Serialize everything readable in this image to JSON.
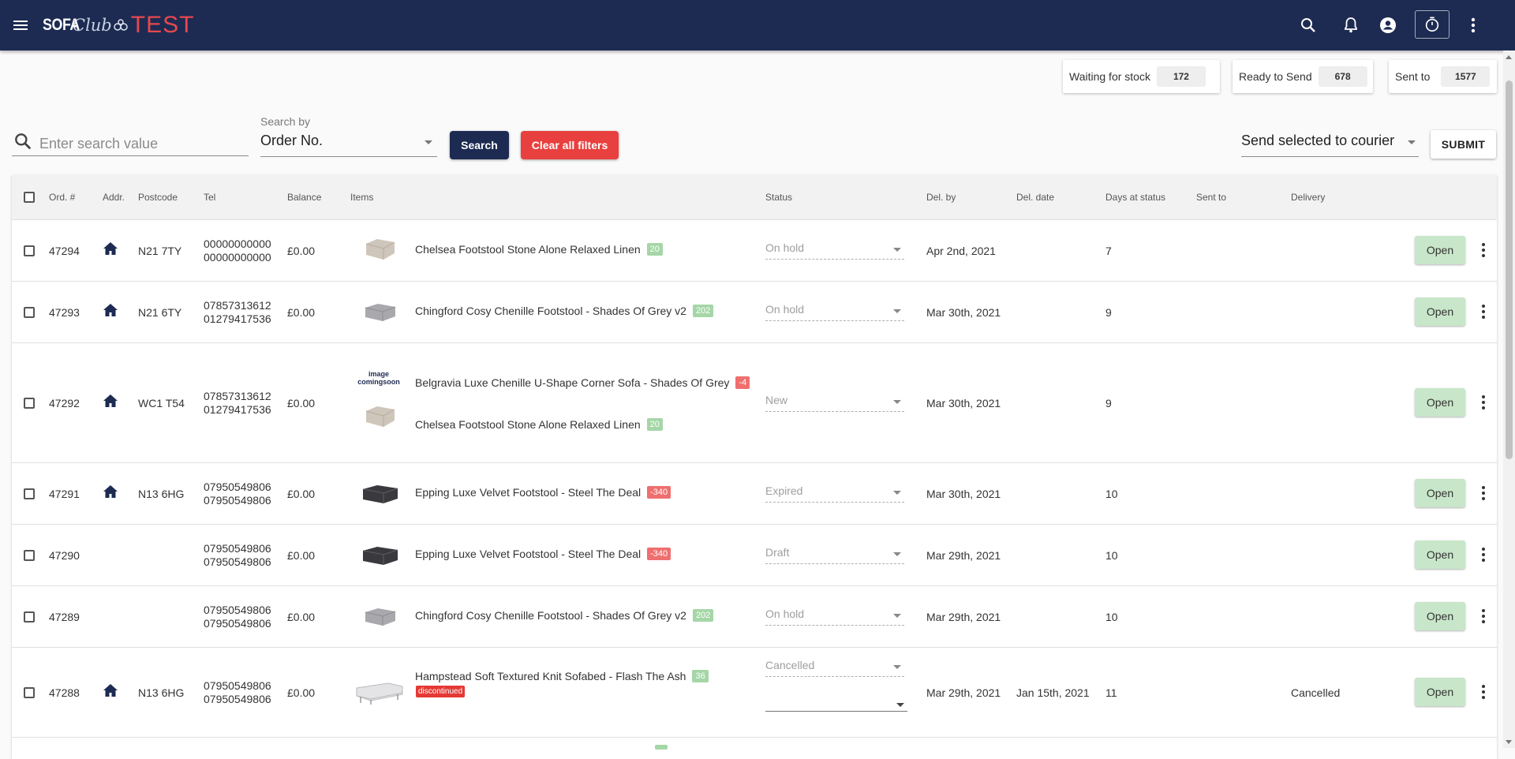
{
  "app": {
    "logo": {
      "part1": "SOFA",
      "part2": "Club",
      "part3": "TEST"
    },
    "colors": {
      "header": "#1d2b52",
      "danger": "#e8403e",
      "open": "#c8e6c9",
      "qty_ok": "#a5d6a7",
      "qty_neg": "#ef6f6f"
    }
  },
  "header_icons": [
    "menu-icon",
    "search-icon",
    "bell-icon",
    "account-icon",
    "timer-icon",
    "more-vert-icon"
  ],
  "counters": [
    {
      "label": "Waiting for stock",
      "value": "172"
    },
    {
      "label": "Ready to Send",
      "value": "678"
    },
    {
      "label": "Sent to",
      "value": "1577"
    }
  ],
  "search": {
    "placeholder": "Enter search value",
    "value": "",
    "search_by_label": "Search by",
    "search_by_value": "Order No.",
    "search_button": "Search",
    "clear_button": "Clear all filters",
    "courier_action": "Send selected to courier",
    "submit_button": "SUBMIT"
  },
  "table": {
    "columns": [
      "Ord. #",
      "Addr.",
      "Postcode",
      "Tel",
      "Balance",
      "Items",
      "Status",
      "Del. by",
      "Del. date",
      "Days at status",
      "Sent to",
      "Delivery"
    ],
    "open_label": "Open",
    "image_placeholder": "image comingsoon",
    "discontinued_label": "discontinued",
    "rows": [
      {
        "order": "47294",
        "has_address": true,
        "postcode": "N21 7TY",
        "tel1": "00000000000",
        "tel2": "00000000000",
        "balance": "£0.00",
        "items": [
          {
            "name": "Chelsea Footstool Stone Alone Relaxed Linen",
            "qty": "20",
            "qty_type": "green",
            "thumb": "footstool-beige"
          }
        ],
        "status": "On hold",
        "del_by": "Apr 2nd, 2021",
        "del_date": "",
        "days": "7",
        "sent_to": "",
        "delivery": ""
      },
      {
        "order": "47293",
        "has_address": true,
        "postcode": "N21 6TY",
        "tel1": "07857313612",
        "tel2": "01279417536",
        "balance": "£0.00",
        "items": [
          {
            "name": "Chingford Cosy Chenille Footstool - Shades Of Grey v2",
            "qty": "202",
            "qty_type": "green",
            "thumb": "footstool-grey"
          }
        ],
        "status": "On hold",
        "del_by": "Mar 30th, 2021",
        "del_date": "",
        "days": "9",
        "sent_to": "",
        "delivery": ""
      },
      {
        "order": "47292",
        "has_address": true,
        "postcode": "WC1 T54",
        "tel1": "07857313612",
        "tel2": "01279417536",
        "balance": "£0.00",
        "items": [
          {
            "name": "Belgravia Luxe Chenille U-Shape Corner Sofa - Shades Of Grey",
            "qty": "-4",
            "qty_type": "red",
            "thumb": "image-coming-soon"
          },
          {
            "name": "Chelsea Footstool Stone Alone Relaxed Linen",
            "qty": "20",
            "qty_type": "green",
            "thumb": "footstool-beige"
          }
        ],
        "status": "New",
        "del_by": "Mar 30th, 2021",
        "del_date": "",
        "days": "9",
        "sent_to": "",
        "delivery": ""
      },
      {
        "order": "47291",
        "has_address": true,
        "postcode": "N13 6HG",
        "tel1": "07950549806",
        "tel2": "07950549806",
        "balance": "£0.00",
        "items": [
          {
            "name": "Epping Luxe Velvet Footstool - Steel The Deal",
            "qty": "-340",
            "qty_type": "red",
            "thumb": "footstool-dark"
          }
        ],
        "status": "Expired",
        "del_by": "Mar 30th, 2021",
        "del_date": "",
        "days": "10",
        "sent_to": "",
        "delivery": ""
      },
      {
        "order": "47290",
        "has_address": false,
        "postcode": "",
        "tel1": "07950549806",
        "tel2": "07950549806",
        "balance": "£0.00",
        "items": [
          {
            "name": "Epping Luxe Velvet Footstool - Steel The Deal",
            "qty": "-340",
            "qty_type": "red",
            "thumb": "footstool-dark"
          }
        ],
        "status": "Draft",
        "del_by": "Mar 29th, 2021",
        "del_date": "",
        "days": "10",
        "sent_to": "",
        "delivery": ""
      },
      {
        "order": "47289",
        "has_address": false,
        "postcode": "",
        "tel1": "07950549806",
        "tel2": "07950549806",
        "balance": "£0.00",
        "items": [
          {
            "name": "Chingford Cosy Chenille Footstool - Shades Of Grey v2",
            "qty": "202",
            "qty_type": "green",
            "thumb": "footstool-grey"
          }
        ],
        "status": "On hold",
        "del_by": "Mar 29th, 2021",
        "del_date": "",
        "days": "10",
        "sent_to": "",
        "delivery": ""
      },
      {
        "order": "47288",
        "has_address": true,
        "postcode": "N13 6HG",
        "tel1": "07950549806",
        "tel2": "07950549806",
        "balance": "£0.00",
        "items": [
          {
            "name": "Hampstead Soft Textured Knit Sofabed - Flash The Ash",
            "qty": "36",
            "qty_type": "green",
            "thumb": "sofabed-grey",
            "discontinued": true
          }
        ],
        "status": "Cancelled",
        "del_by": "Mar 29th, 2021",
        "del_date": "Jan 15th, 2021",
        "days": "11",
        "sent_to": "",
        "delivery": "Cancelled"
      }
    ]
  }
}
